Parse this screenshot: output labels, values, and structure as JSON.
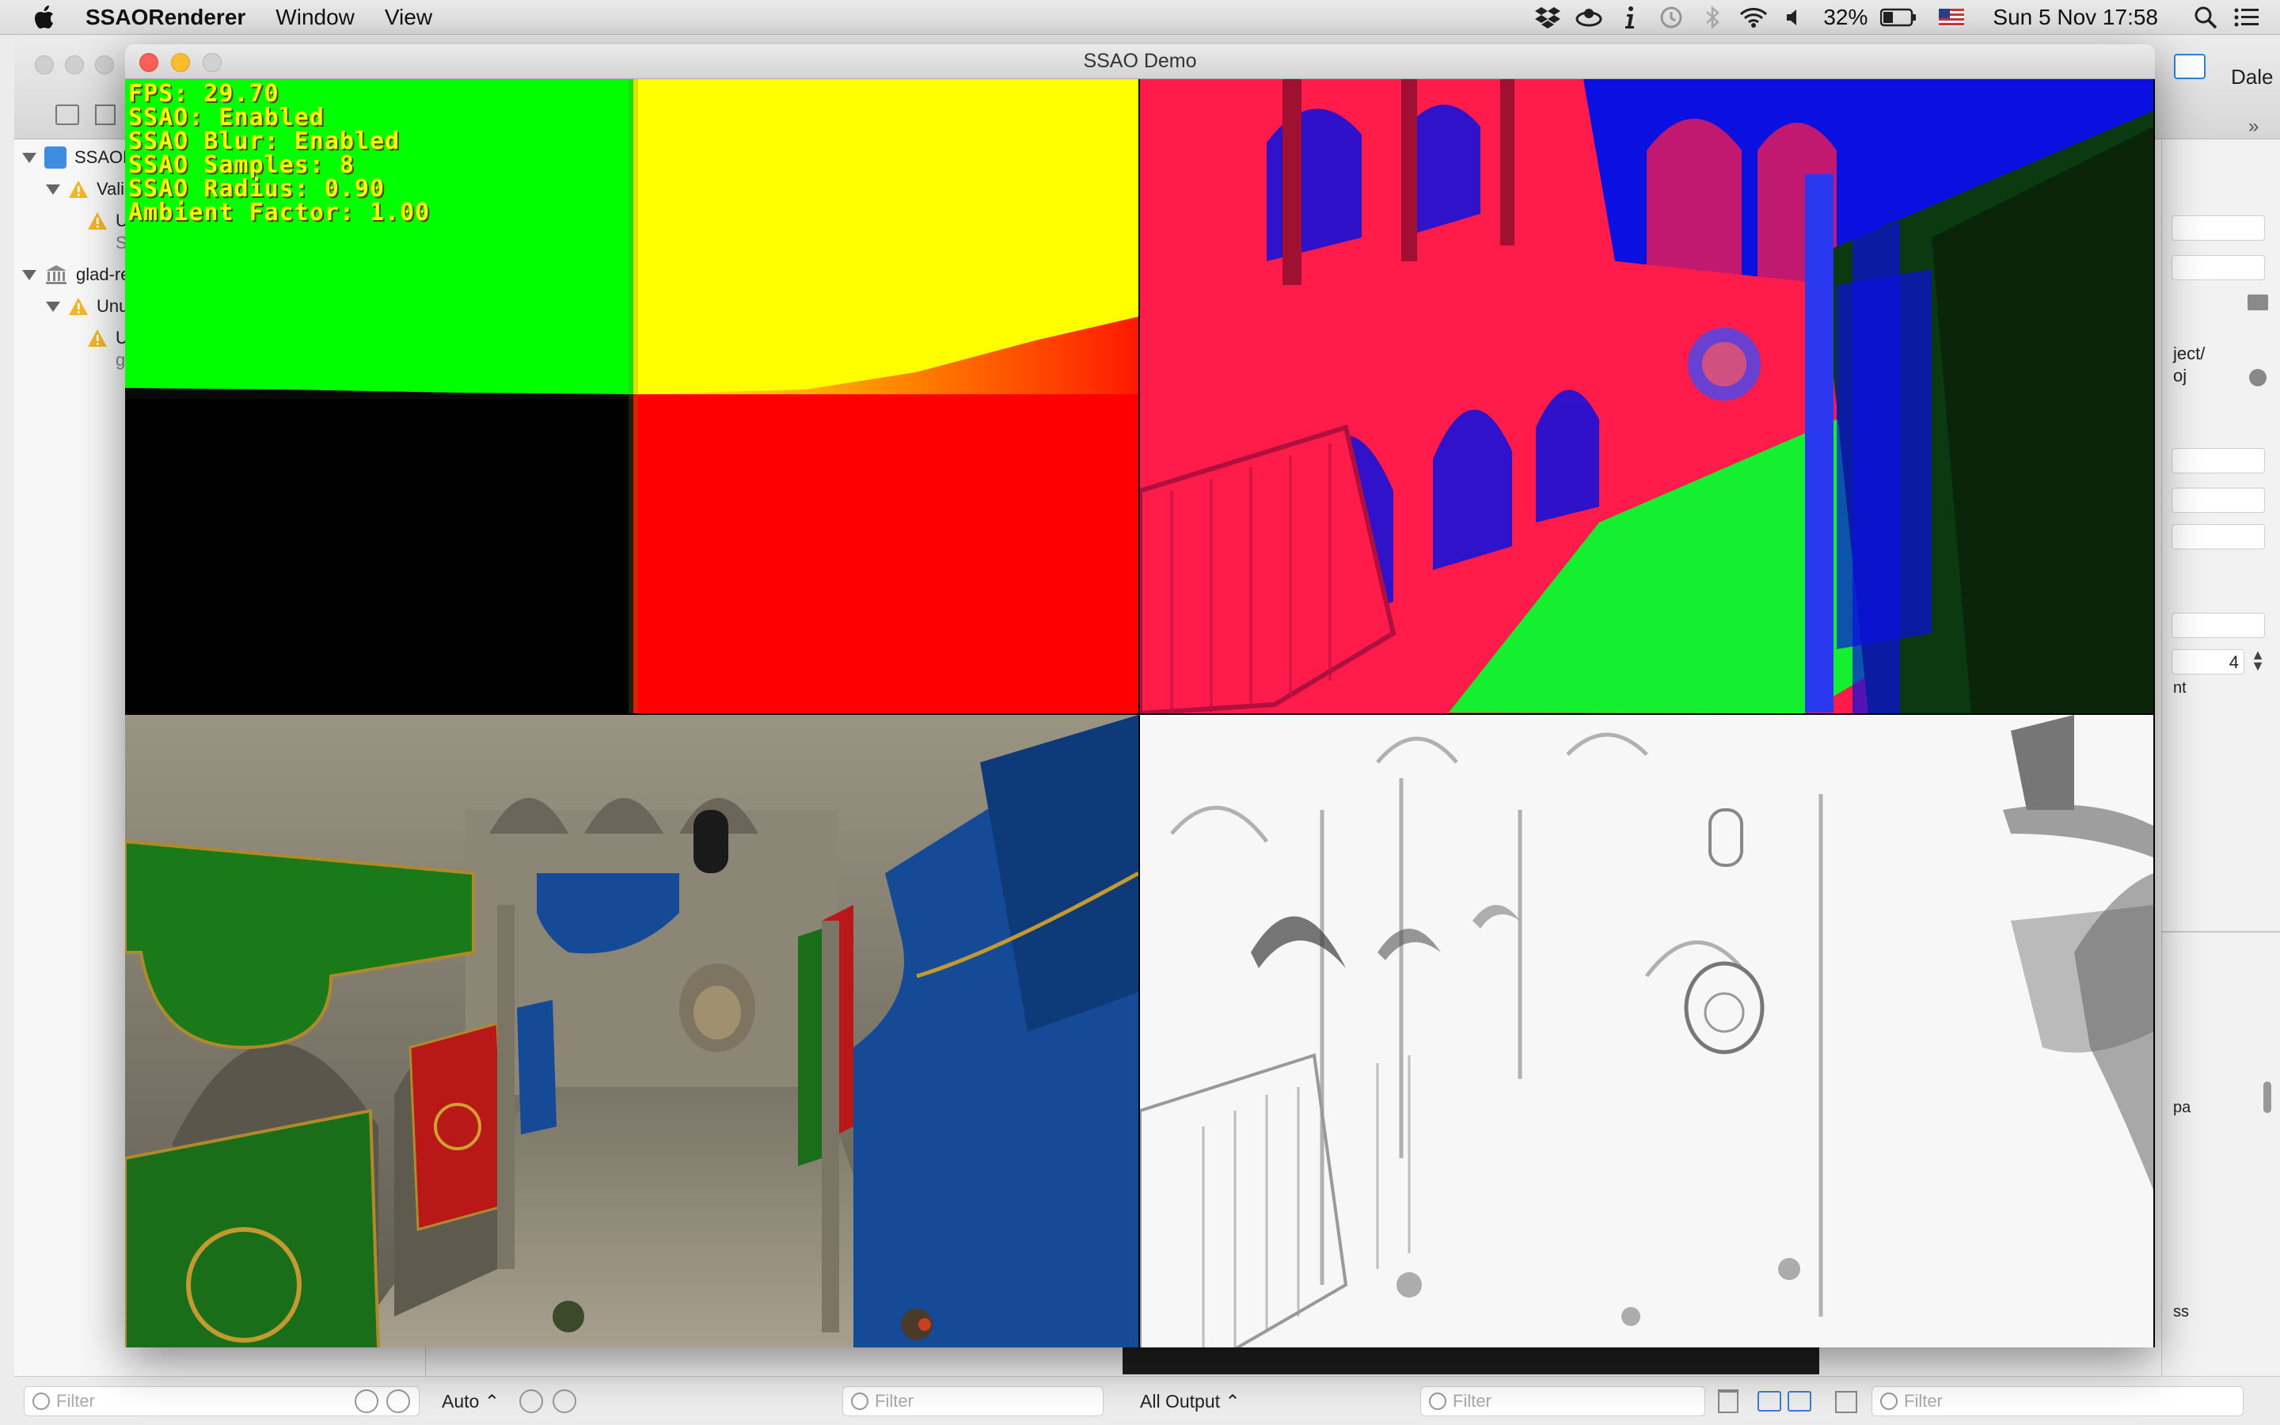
{
  "menubar": {
    "app_name": "SSAORenderer",
    "items": [
      "Window",
      "View"
    ],
    "status": {
      "battery": "32%",
      "datetime": "Sun 5 Nov  17:58"
    },
    "icons": [
      "dropbox-icon",
      "cloud-icon",
      "info-icon",
      "time-machine-icon",
      "bluetooth-icon",
      "wifi-icon",
      "volume-icon",
      "battery-icon",
      "flag-icon",
      "search-icon",
      "list-icon"
    ]
  },
  "xcode": {
    "navigator": {
      "rows": [
        {
          "label": "SSAOR",
          "level": 0,
          "kind": "project"
        },
        {
          "label": "Vali",
          "level": 1,
          "kind": "warning-group"
        },
        {
          "label": "U",
          "level": 2,
          "kind": "warning"
        },
        {
          "label": "S",
          "level": 3,
          "kind": "sub"
        },
        {
          "label": "glad-re",
          "level": 0,
          "kind": "library"
        },
        {
          "label": "Unu",
          "level": 1,
          "kind": "warning-group"
        },
        {
          "label": "U",
          "level": 2,
          "kind": "warning"
        },
        {
          "label": "g",
          "level": 3,
          "kind": "sub"
        }
      ]
    },
    "right_edge": {
      "user": "Dale",
      "path_part_1": "ject/",
      "path_part_2": "oj",
      "stepper_value": "4",
      "label_nt": "nt",
      "label_pa": "pa",
      "label_ss": "ss"
    },
    "bottom": {
      "filter_placeholder": "Filter",
      "auto_label": "Auto",
      "all_output_label": "All Output"
    }
  },
  "ssao_window": {
    "title": "SSAO Demo",
    "hud": {
      "fps": "FPS: 29.70",
      "ssao": "SSAO: Enabled",
      "ssao_blur": "SSAO Blur: Enabled",
      "ssao_samples": "SSAO Samples: 8",
      "ssao_radius": "SSAO Radius: 0.90",
      "ambient_factor": "Ambient Factor: 1.00"
    },
    "colors": {
      "position_green": "#00ff00",
      "position_yellow": "#ffff00",
      "position_red": "#ff0000",
      "normal_red": "#ff1c4a",
      "normal_blue": "#0a10e0",
      "normal_green": "#14f030",
      "banner_green": "#1a7a1a",
      "banner_red": "#b81818",
      "banner_blue": "#154a96"
    }
  }
}
